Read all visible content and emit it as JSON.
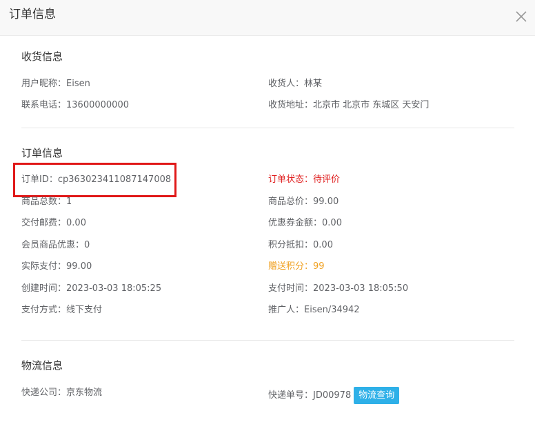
{
  "dialog": {
    "title": "订单信息",
    "close_icon": "close-icon"
  },
  "shipping": {
    "title": "收货信息",
    "nickname": {
      "label": "用户昵称：",
      "value": "Eisen"
    },
    "receiver": {
      "label": "收货人：",
      "value": "林某"
    },
    "phone": {
      "label": "联系电话：",
      "value": "13600000000"
    },
    "address": {
      "label": "收货地址：",
      "value": "北京市 北京市 东城区 天安门"
    }
  },
  "order": {
    "title": "订单信息",
    "order_id": {
      "label": "订单ID：",
      "value": "cp363023411087147008"
    },
    "status": {
      "label": "订单状态：",
      "value": "待评价",
      "color": "#e02020"
    },
    "item_count": {
      "label": "商品总数：",
      "value": "1"
    },
    "total_price": {
      "label": "商品总价：",
      "value": "99.00"
    },
    "postage": {
      "label": "交付邮费：",
      "value": "0.00"
    },
    "coupon": {
      "label": "优惠券金额：",
      "value": "0.00"
    },
    "member_discount": {
      "label": "会员商品优惠：",
      "value": "0"
    },
    "points_deduction": {
      "label": "积分抵扣：",
      "value": "0.00"
    },
    "paid": {
      "label": "实际支付：",
      "value": "99.00"
    },
    "bonus_points": {
      "label": "赠送积分：",
      "value": "99",
      "color": "#f0a020"
    },
    "created_at": {
      "label": "创建时间：",
      "value": "2023-03-03 18:05:25"
    },
    "paid_at": {
      "label": "支付时间：",
      "value": "2023-03-03 18:05:50"
    },
    "pay_method": {
      "label": "支付方式：",
      "value": "线下支付"
    },
    "promoter": {
      "label": "推广人：",
      "value": "Eisen/34942"
    }
  },
  "logistics": {
    "title": "物流信息",
    "company": {
      "label": "快递公司：",
      "value": "京东物流"
    },
    "tracking_no": {
      "label": "快递单号：",
      "value": "JD00978"
    },
    "track_button": "物流查询"
  },
  "highlight_color": "#e01818",
  "accent_color": "#2eb0e8"
}
